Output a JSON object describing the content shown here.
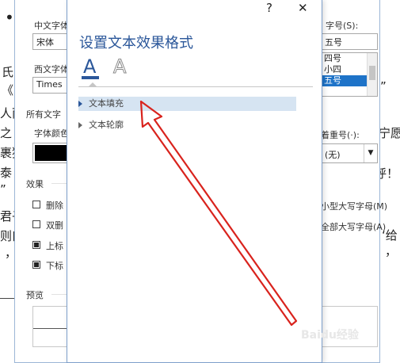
{
  "document": {
    "bullet": "•",
    "fragments": [
      "氏",
      "《",
      "人而",
      "之",
      "裹猛",
      "泰",
      "”",
      "君子",
      "则曰",
      "，",
      "”",
      "宁愿",
      "呜呼！",
      "‘给",
      "，"
    ]
  },
  "font_dialog": {
    "chinese_font_label": "中文字体",
    "chinese_font_value": "宋体",
    "western_font_label": "西文字体",
    "western_font_value": "Times",
    "all_text_header": "所有文字",
    "font_color_label": "字体颜色",
    "emphasis_label": "着重号(·):",
    "emphasis_value": "(无)",
    "size_label": "字号(S):",
    "size_input": "五号",
    "size_options": [
      "四号",
      "小四",
      "五号"
    ],
    "effects_header": "效果",
    "strikethrough": "删除",
    "double_strikethrough": "双删",
    "superscript": "上标",
    "subscript": "下标",
    "small_caps": "小型大写字母(M)",
    "all_caps": "全部大写字母(A)",
    "preview_header": "预览",
    "superscript_checked": false,
    "subscript_checked": false,
    "color_value": "#000000"
  },
  "effects_dialog": {
    "title": "设置文本效果格式",
    "help": "?",
    "close": "✕",
    "tab_fill_icon": "A",
    "tab_outline_icon": "A",
    "sections": [
      {
        "label": "文本填充",
        "expanded": false,
        "highlight": true
      },
      {
        "label": "文本轮廓",
        "expanded": false,
        "highlight": false
      }
    ]
  },
  "watermark": {
    "text": "Baidu经验"
  },
  "colors": {
    "accent": "#2b579a",
    "annotation_red": "#d9231d",
    "selection": "#1e73c8"
  }
}
